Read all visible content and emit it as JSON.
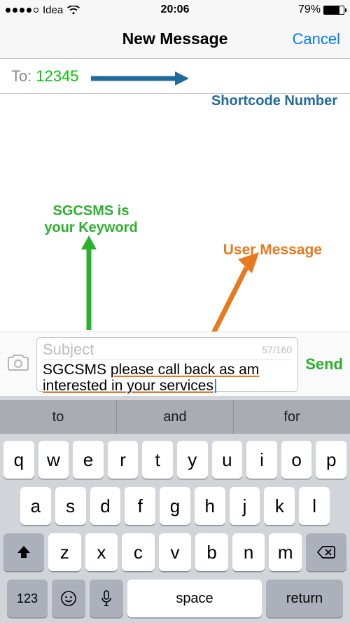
{
  "status": {
    "carrier": "Idea",
    "time": "20:06",
    "battery_pct": "79%",
    "battery_fill": 79
  },
  "nav": {
    "title": "New Message",
    "cancel": "Cancel"
  },
  "to": {
    "label": "To:",
    "value": "12345"
  },
  "annotations": {
    "shortcode": "Shortcode Number",
    "keyword_line1": "SGCSMS is",
    "keyword_line2": "your Keyword",
    "usermsg": "User Message"
  },
  "compose": {
    "subject_placeholder": "Subject",
    "char_count": "57/160",
    "body_keyword": "SGCSMS ",
    "body_rest_1": "please call back as am",
    "body_rest_2": "interested in your services",
    "send": "Send"
  },
  "keyboard": {
    "suggestions": [
      "to",
      "and",
      "for"
    ],
    "row1": [
      "q",
      "w",
      "e",
      "r",
      "t",
      "y",
      "u",
      "i",
      "o",
      "p"
    ],
    "row2": [
      "a",
      "s",
      "d",
      "f",
      "g",
      "h",
      "j",
      "k",
      "l"
    ],
    "row3": [
      "z",
      "x",
      "c",
      "v",
      "b",
      "n",
      "m"
    ],
    "k123": "123",
    "space": "space",
    "return": "return"
  }
}
